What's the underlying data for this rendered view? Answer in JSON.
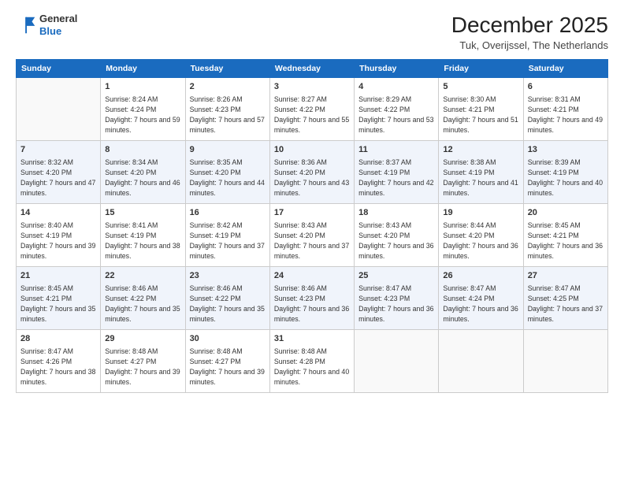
{
  "logo": {
    "general": "General",
    "blue": "Blue"
  },
  "header": {
    "month": "December 2025",
    "location": "Tuk, Overijssel, The Netherlands"
  },
  "weekdays": [
    "Sunday",
    "Monday",
    "Tuesday",
    "Wednesday",
    "Thursday",
    "Friday",
    "Saturday"
  ],
  "weeks": [
    [
      {
        "day": null,
        "detail": null
      },
      {
        "day": "1",
        "sunrise": "8:24 AM",
        "sunset": "4:24 PM",
        "daylight": "7 hours and 59 minutes."
      },
      {
        "day": "2",
        "sunrise": "8:26 AM",
        "sunset": "4:23 PM",
        "daylight": "7 hours and 57 minutes."
      },
      {
        "day": "3",
        "sunrise": "8:27 AM",
        "sunset": "4:22 PM",
        "daylight": "7 hours and 55 minutes."
      },
      {
        "day": "4",
        "sunrise": "8:29 AM",
        "sunset": "4:22 PM",
        "daylight": "7 hours and 53 minutes."
      },
      {
        "day": "5",
        "sunrise": "8:30 AM",
        "sunset": "4:21 PM",
        "daylight": "7 hours and 51 minutes."
      },
      {
        "day": "6",
        "sunrise": "8:31 AM",
        "sunset": "4:21 PM",
        "daylight": "7 hours and 49 minutes."
      }
    ],
    [
      {
        "day": "7",
        "sunrise": "8:32 AM",
        "sunset": "4:20 PM",
        "daylight": "7 hours and 47 minutes."
      },
      {
        "day": "8",
        "sunrise": "8:34 AM",
        "sunset": "4:20 PM",
        "daylight": "7 hours and 46 minutes."
      },
      {
        "day": "9",
        "sunrise": "8:35 AM",
        "sunset": "4:20 PM",
        "daylight": "7 hours and 44 minutes."
      },
      {
        "day": "10",
        "sunrise": "8:36 AM",
        "sunset": "4:20 PM",
        "daylight": "7 hours and 43 minutes."
      },
      {
        "day": "11",
        "sunrise": "8:37 AM",
        "sunset": "4:19 PM",
        "daylight": "7 hours and 42 minutes."
      },
      {
        "day": "12",
        "sunrise": "8:38 AM",
        "sunset": "4:19 PM",
        "daylight": "7 hours and 41 minutes."
      },
      {
        "day": "13",
        "sunrise": "8:39 AM",
        "sunset": "4:19 PM",
        "daylight": "7 hours and 40 minutes."
      }
    ],
    [
      {
        "day": "14",
        "sunrise": "8:40 AM",
        "sunset": "4:19 PM",
        "daylight": "7 hours and 39 minutes."
      },
      {
        "day": "15",
        "sunrise": "8:41 AM",
        "sunset": "4:19 PM",
        "daylight": "7 hours and 38 minutes."
      },
      {
        "day": "16",
        "sunrise": "8:42 AM",
        "sunset": "4:19 PM",
        "daylight": "7 hours and 37 minutes."
      },
      {
        "day": "17",
        "sunrise": "8:43 AM",
        "sunset": "4:20 PM",
        "daylight": "7 hours and 37 minutes."
      },
      {
        "day": "18",
        "sunrise": "8:43 AM",
        "sunset": "4:20 PM",
        "daylight": "7 hours and 36 minutes."
      },
      {
        "day": "19",
        "sunrise": "8:44 AM",
        "sunset": "4:20 PM",
        "daylight": "7 hours and 36 minutes."
      },
      {
        "day": "20",
        "sunrise": "8:45 AM",
        "sunset": "4:21 PM",
        "daylight": "7 hours and 36 minutes."
      }
    ],
    [
      {
        "day": "21",
        "sunrise": "8:45 AM",
        "sunset": "4:21 PM",
        "daylight": "7 hours and 35 minutes."
      },
      {
        "day": "22",
        "sunrise": "8:46 AM",
        "sunset": "4:22 PM",
        "daylight": "7 hours and 35 minutes."
      },
      {
        "day": "23",
        "sunrise": "8:46 AM",
        "sunset": "4:22 PM",
        "daylight": "7 hours and 35 minutes."
      },
      {
        "day": "24",
        "sunrise": "8:46 AM",
        "sunset": "4:23 PM",
        "daylight": "7 hours and 36 minutes."
      },
      {
        "day": "25",
        "sunrise": "8:47 AM",
        "sunset": "4:23 PM",
        "daylight": "7 hours and 36 minutes."
      },
      {
        "day": "26",
        "sunrise": "8:47 AM",
        "sunset": "4:24 PM",
        "daylight": "7 hours and 36 minutes."
      },
      {
        "day": "27",
        "sunrise": "8:47 AM",
        "sunset": "4:25 PM",
        "daylight": "7 hours and 37 minutes."
      }
    ],
    [
      {
        "day": "28",
        "sunrise": "8:47 AM",
        "sunset": "4:26 PM",
        "daylight": "7 hours and 38 minutes."
      },
      {
        "day": "29",
        "sunrise": "8:48 AM",
        "sunset": "4:27 PM",
        "daylight": "7 hours and 39 minutes."
      },
      {
        "day": "30",
        "sunrise": "8:48 AM",
        "sunset": "4:27 PM",
        "daylight": "7 hours and 39 minutes."
      },
      {
        "day": "31",
        "sunrise": "8:48 AM",
        "sunset": "4:28 PM",
        "daylight": "7 hours and 40 minutes."
      },
      {
        "day": null,
        "detail": null
      },
      {
        "day": null,
        "detail": null
      },
      {
        "day": null,
        "detail": null
      }
    ]
  ],
  "labels": {
    "sunrise": "Sunrise:",
    "sunset": "Sunset:",
    "daylight": "Daylight:"
  }
}
